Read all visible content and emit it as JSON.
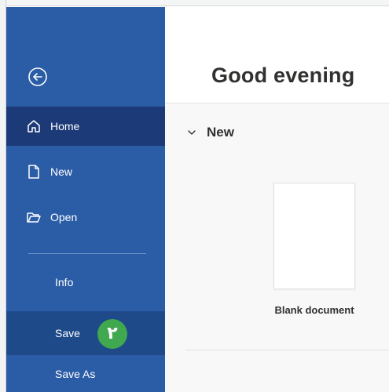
{
  "sidebar": {
    "back_icon": "back-arrow-icon",
    "items": [
      {
        "id": "home",
        "label": "Home",
        "icon": "home-icon"
      },
      {
        "id": "new",
        "label": "New",
        "icon": "new-document-icon"
      },
      {
        "id": "open",
        "label": "Open",
        "icon": "folder-open-icon"
      },
      {
        "id": "info",
        "label": "Info"
      },
      {
        "id": "save",
        "label": "Save"
      },
      {
        "id": "save-as",
        "label": "Save As"
      }
    ],
    "save_badge": "٢"
  },
  "main": {
    "greeting": "Good evening",
    "section": {
      "label": "New",
      "icon": "chevron-down-icon"
    },
    "templates": [
      {
        "label": "Blank document"
      }
    ]
  },
  "colors": {
    "sidebar_bg": "#2b5ca6",
    "home_active_bg": "#1c3a78",
    "save_active_bg": "#1e4a8a",
    "badge_bg": "#40a84e",
    "text_dark": "#323130"
  }
}
